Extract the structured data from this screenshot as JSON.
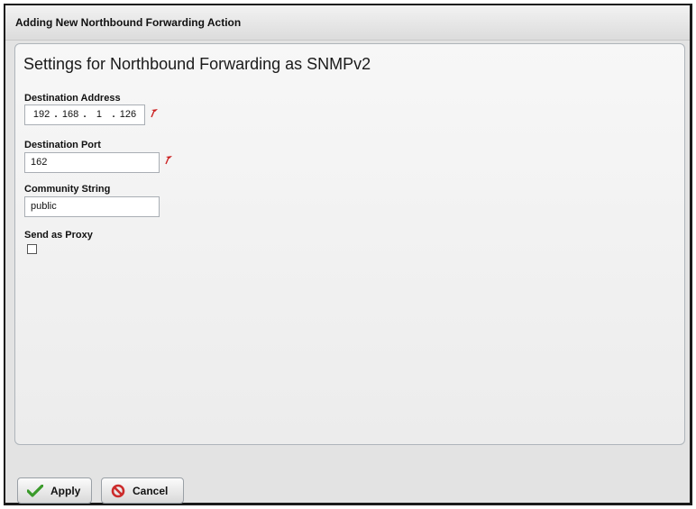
{
  "dialog": {
    "title": "Adding New Northbound Forwarding Action"
  },
  "panel": {
    "heading": "Settings for Northbound Forwarding as SNMPv2"
  },
  "fields": {
    "destination_address": {
      "label": "Destination Address",
      "octets": [
        "192",
        "168",
        "1",
        "126"
      ],
      "separator": ".",
      "required": true
    },
    "destination_port": {
      "label": "Destination Port",
      "value": "162",
      "required": true
    },
    "community_string": {
      "label": "Community String",
      "value": "public"
    },
    "send_as_proxy": {
      "label": "Send as Proxy",
      "checked": false
    }
  },
  "buttons": {
    "apply_label": "Apply",
    "cancel_label": "Cancel"
  },
  "icons": {
    "required": "required-marker-icon",
    "apply": "checkmark-icon",
    "cancel": "cancel-icon"
  },
  "colors": {
    "required_marker": "#cc2222",
    "apply_icon": "#3a9a2a",
    "cancel_icon": "#cc2b2b"
  }
}
